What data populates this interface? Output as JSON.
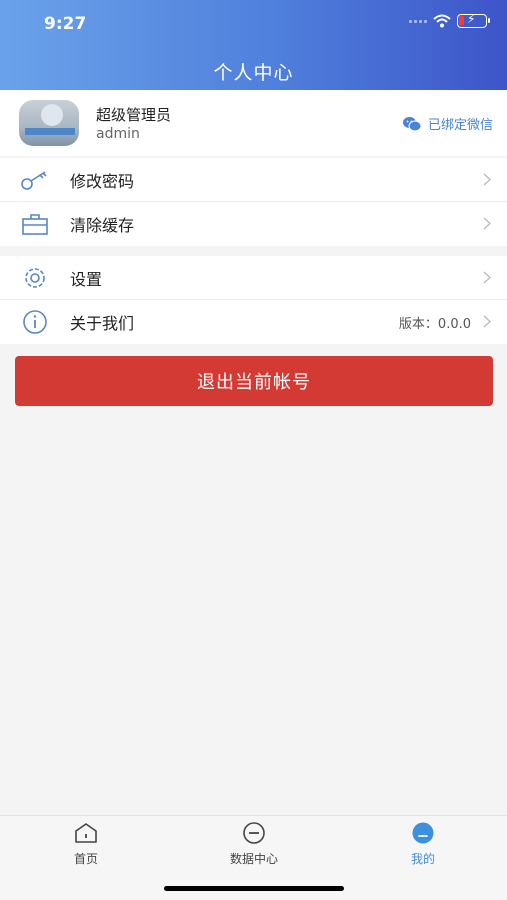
{
  "status_bar": {
    "time": "9:27"
  },
  "header": {
    "title": "个人中心"
  },
  "profile": {
    "name": "超级管理员",
    "account": "admin",
    "wechat_status": "已绑定微信"
  },
  "menu_group_1": [
    {
      "label": "修改密码",
      "icon": "key-icon"
    },
    {
      "label": "清除缓存",
      "icon": "briefcase-icon"
    }
  ],
  "menu_group_2": [
    {
      "label": "设置",
      "icon": "gear-icon"
    },
    {
      "label": "关于我们",
      "icon": "info-icon",
      "value": "版本：0.0.0"
    }
  ],
  "logout": {
    "label": "退出当前帐号"
  },
  "tabbar": {
    "tabs": [
      {
        "label": "首页",
        "icon": "home-icon"
      },
      {
        "label": "数据中心",
        "icon": "data-center-icon"
      },
      {
        "label": "我的",
        "icon": "profile-icon",
        "active": true
      }
    ]
  },
  "colors": {
    "accent": "#4f7fdc",
    "danger": "#d33a34",
    "active_tab": "#3d8fe0"
  }
}
